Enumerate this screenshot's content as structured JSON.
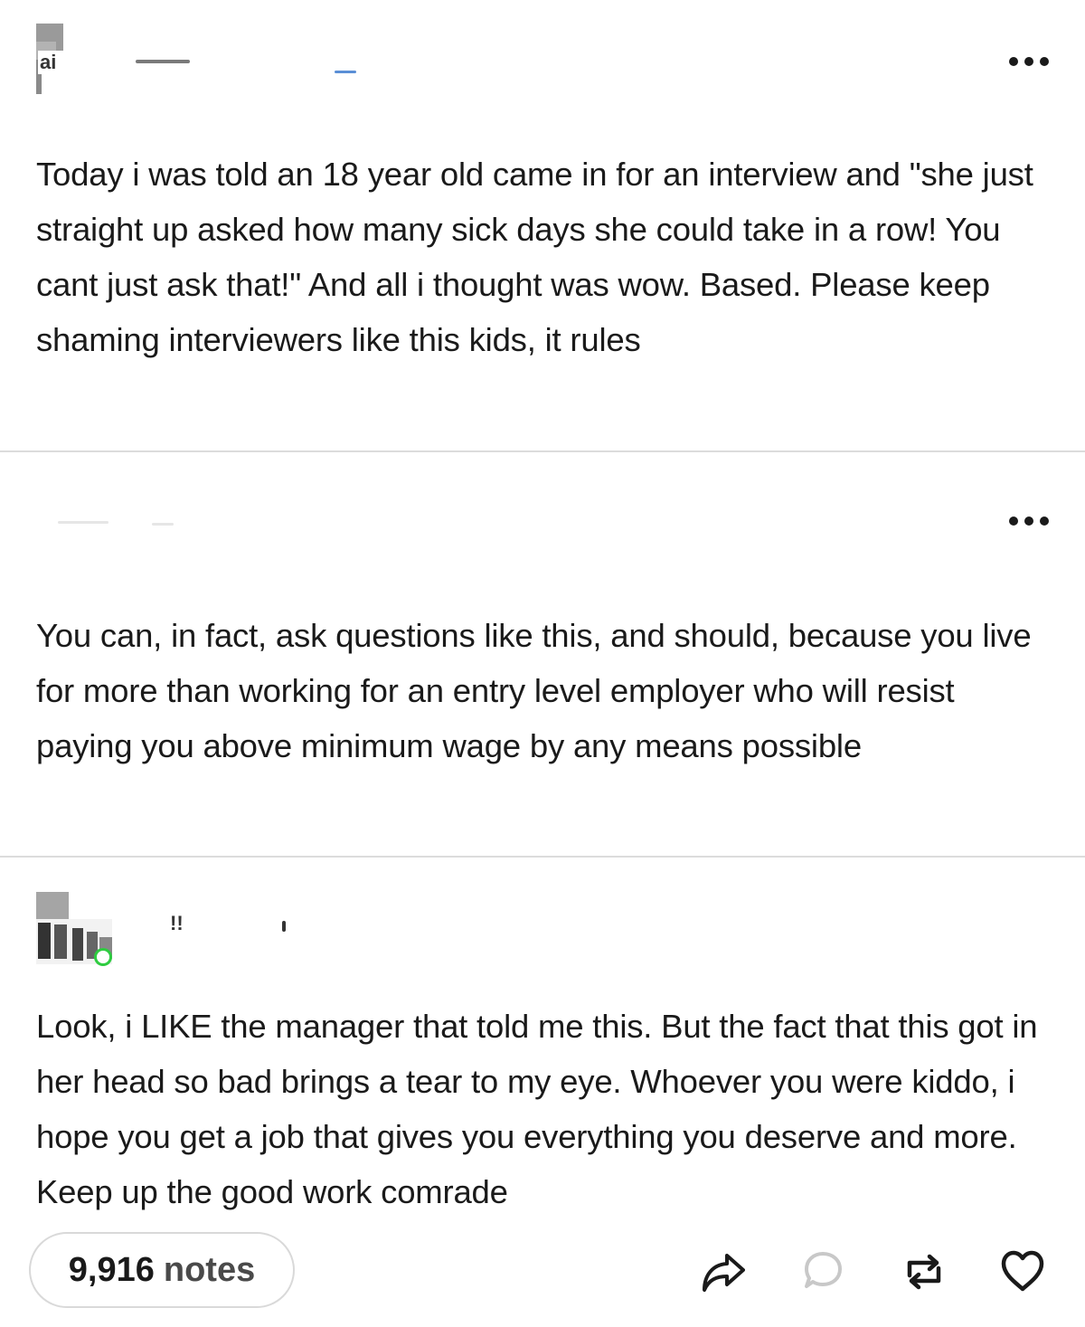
{
  "posts": [
    {
      "avatar_text": "ai",
      "text": "Today i was told an 18 year old came in for an interview and \"she just straight up asked how many sick days she could take in a row! You cant just ask that!\" And all i thought was wow. Based. Please keep shaming interviewers like this kids, it rules"
    },
    {
      "text": "You can, in fact, ask questions like this, and should, because you live for more than working for an entry level employer who will resist paying you above minimum wage by any means possible"
    },
    {
      "username_fragment": "!!",
      "text": "Look, i LIKE the manager that told me this. But the fact that this got in her head so bad brings a tear to my eye. Whoever you were kiddo, i hope you get a job that gives you everything you deserve and more. Keep up the good work comrade"
    }
  ],
  "footer": {
    "notes_count": "9,916",
    "notes_label": "notes",
    "icons": [
      "share-icon",
      "reply-icon",
      "reblog-icon",
      "like-icon"
    ]
  },
  "colors": {
    "text": "#1a1a1a",
    "divider": "#dcdcdc",
    "online_dot": "#2ecc40",
    "reply_icon": "#c8c8c8"
  }
}
